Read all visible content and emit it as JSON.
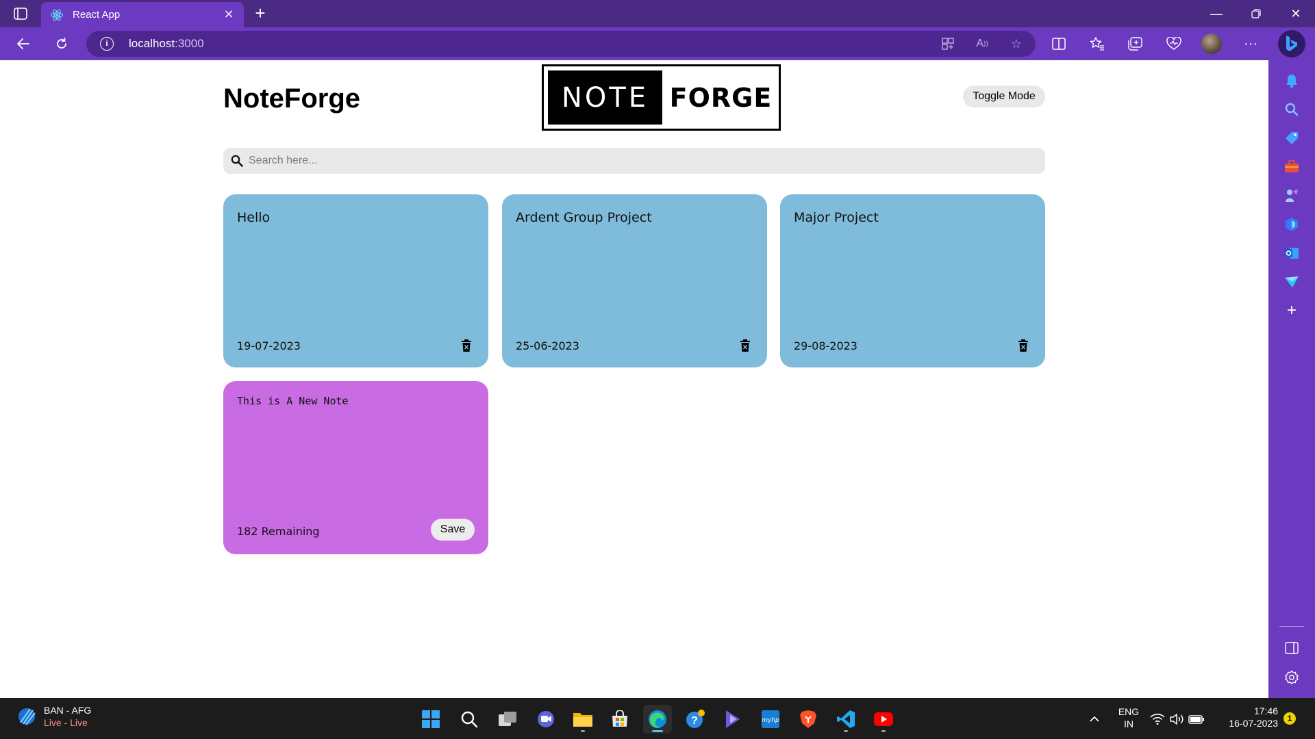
{
  "browser": {
    "tab_title": "React App",
    "url_host": "localhost",
    "url_port": ":3000"
  },
  "app": {
    "title": "NoteForge",
    "logo_left": "NOTE",
    "logo_right": "FORGE",
    "toggle_label": "Toggle Mode",
    "search_placeholder": "Search here...",
    "notes": [
      {
        "text": "Hello",
        "date": "19-07-2023"
      },
      {
        "text": "Ardent Group Project",
        "date": "25-06-2023"
      },
      {
        "text": "Major Project",
        "date": "29-08-2023"
      }
    ],
    "new_note": {
      "text": "This is A New Note",
      "remaining": "182 Remaining",
      "save_label": "Save"
    },
    "colors": {
      "note_bg": "#7fbbdb",
      "new_note_bg": "#c96be3",
      "browser_accent": "#6b3ac0"
    }
  },
  "taskbar": {
    "widget_title": "BAN - AFG",
    "widget_subtitle": "Live - Live",
    "lang_line1": "ENG",
    "lang_line2": "IN",
    "time": "17:46",
    "date": "16-07-2023",
    "notification_count": "1"
  }
}
